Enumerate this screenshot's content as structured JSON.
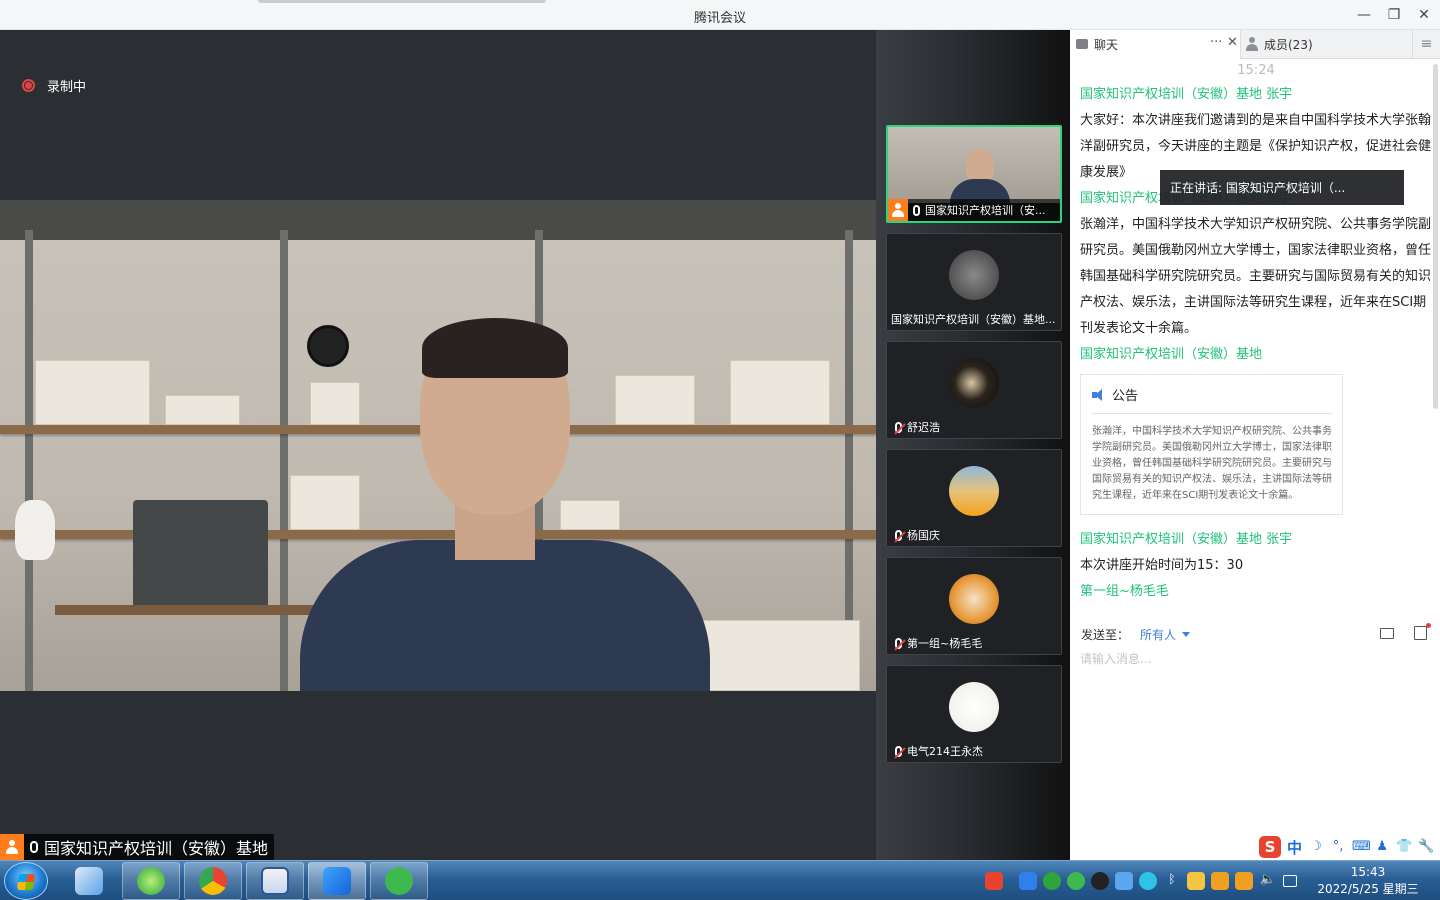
{
  "window": {
    "title": "腾讯会议",
    "minimize": "—",
    "maximize": "❐",
    "close": "✕"
  },
  "stage": {
    "recording_label": "录制中",
    "speaker_name": "国家知识产权培训（安徽）基地"
  },
  "strip": {
    "tiles": [
      {
        "name": "国家知识产权培训（安...",
        "active": true,
        "host": true,
        "muted": false
      },
      {
        "name": "国家知识产权培训（安徽）基地...",
        "active": false,
        "host": false,
        "muted": null
      },
      {
        "name": "舒迟浩",
        "active": false,
        "host": false,
        "muted": true
      },
      {
        "name": "杨国庆",
        "active": false,
        "host": false,
        "muted": true
      },
      {
        "name": "第一组~杨毛毛",
        "active": false,
        "host": false,
        "muted": true
      },
      {
        "name": "电气214王永杰",
        "active": false,
        "host": false,
        "muted": true
      }
    ]
  },
  "panel": {
    "tab_chat": "聊天",
    "tab_members": "成员(23)",
    "tab_more": "···",
    "tab_close": "✕",
    "tab_menu": "≡",
    "time": "15:24",
    "messages": [
      {
        "sender": "国家知识产权培训（安徽）基地  张宇",
        "text": "大家好：本次讲座我们邀请到的是来自中国科学技术大学张翰洋副研究员，今天讲座的主题是《保护知识产权，促进社会健康发展》"
      },
      {
        "sender": "国家知识产权培训（安徽）基地  张宇",
        "text": "张瀚洋，中国科学技术大学知识产权研究院、公共事务学院副研究员。美国俄勒冈州立大学博士，国家法律职业资格，曾任韩国基础科学研究院研究员。主要研究与国际贸易有关的知识产权法、娱乐法，主讲国际法等研究生课程，近年来在SCI期刊发表论文十余篇。"
      },
      {
        "sender": "国家知识产权培训（安徽）基地",
        "text": ""
      }
    ],
    "notice": {
      "title": "公告",
      "body": "张瀚洋，中国科学技术大学知识产权研究院、公共事务学院副研究员。美国俄勒冈州立大学博士，国家法律职业资格，曾任韩国基础科学研究院研究员。主要研究与国际贸易有关的知识产权法、娱乐法，主讲国际法等研究生课程，近年来在SCI期刊发表论文十余篇。"
    },
    "messages2": [
      {
        "sender": "国家知识产权培训（安徽）基地  张宇",
        "text": "本次讲座开始时间为15：30"
      },
      {
        "sender": "第一组~杨毛毛",
        "text": ""
      }
    ],
    "toast": "正在讲话: 国家知识产权培训（...",
    "send_label": "发送至：",
    "send_to": "所有人",
    "input_placeholder": "请输入消息..."
  },
  "ime": {
    "mode": "中",
    "moon": "☽",
    "dot": "°,",
    "keyboard": "⌨",
    "user": "♟",
    "shirt": "👕",
    "wrench": "🔧"
  },
  "taskbar": {
    "time": "15:43",
    "date": "2022/5/25 星期三"
  },
  "colors": {
    "accent_green": "#20c27a",
    "link_blue": "#3b82d8",
    "host_orange": "#ff7d1a",
    "record_red": "#e34343"
  }
}
